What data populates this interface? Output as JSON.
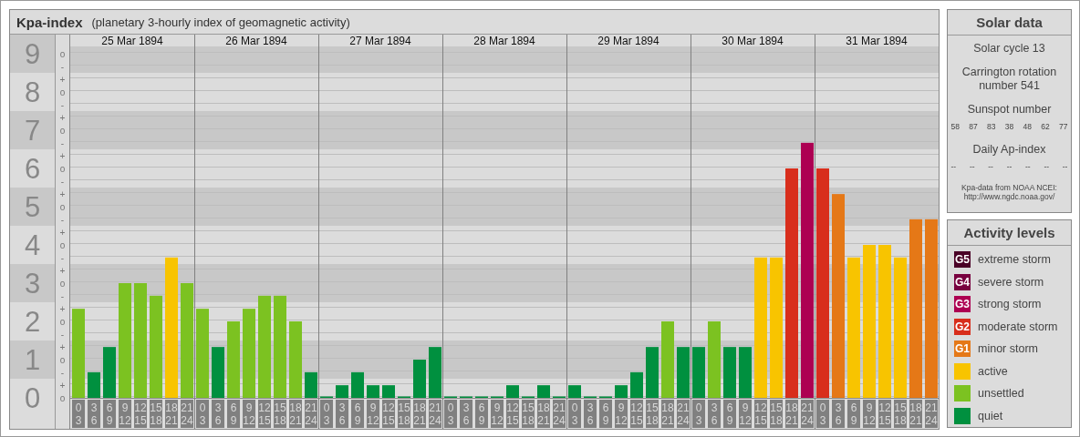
{
  "header": {
    "title": "Kpa-index",
    "subtitle": "(planetary 3-hourly index of geomagnetic activity)"
  },
  "scale": [
    {
      "marks": [
        "o",
        "-"
      ]
    },
    {
      "marks": [
        "+",
        "o",
        "-"
      ]
    },
    {
      "marks": [
        "+",
        "o",
        "-"
      ]
    },
    {
      "marks": [
        "+",
        "o",
        "-"
      ]
    },
    {
      "marks": [
        "+",
        "o",
        "-"
      ]
    },
    {
      "marks": [
        "+",
        "o",
        "-"
      ]
    },
    {
      "marks": [
        "+",
        "o",
        "-"
      ]
    },
    {
      "marks": [
        "+",
        "o",
        "-"
      ]
    },
    {
      "marks": [
        "+",
        "o",
        "-"
      ]
    },
    {
      "marks": [
        "+",
        "o"
      ]
    }
  ],
  "days": [
    {
      "date": "25 Mar 1894",
      "intervals": [
        [
          "0",
          "3"
        ],
        [
          "3",
          "6"
        ],
        [
          "6",
          "9"
        ],
        [
          "9",
          "12"
        ],
        [
          "12",
          "15"
        ],
        [
          "15",
          "18"
        ],
        [
          "18",
          "21"
        ],
        [
          "21",
          "24"
        ]
      ]
    },
    {
      "date": "26 Mar 1894",
      "intervals": [
        [
          "0",
          "3"
        ],
        [
          "3",
          "6"
        ],
        [
          "6",
          "9"
        ],
        [
          "9",
          "12"
        ],
        [
          "12",
          "15"
        ],
        [
          "15",
          "18"
        ],
        [
          "18",
          "21"
        ],
        [
          "21",
          "24"
        ]
      ]
    },
    {
      "date": "27 Mar 1894",
      "intervals": [
        [
          "0",
          "3"
        ],
        [
          "3",
          "6"
        ],
        [
          "6",
          "9"
        ],
        [
          "9",
          "12"
        ],
        [
          "12",
          "15"
        ],
        [
          "15",
          "18"
        ],
        [
          "18",
          "21"
        ],
        [
          "21",
          "24"
        ]
      ]
    },
    {
      "date": "28 Mar 1894",
      "intervals": [
        [
          "0",
          "3"
        ],
        [
          "3",
          "6"
        ],
        [
          "6",
          "9"
        ],
        [
          "9",
          "12"
        ],
        [
          "12",
          "15"
        ],
        [
          "15",
          "18"
        ],
        [
          "18",
          "21"
        ],
        [
          "21",
          "24"
        ]
      ]
    },
    {
      "date": "29 Mar 1894",
      "intervals": [
        [
          "0",
          "3"
        ],
        [
          "3",
          "6"
        ],
        [
          "6",
          "9"
        ],
        [
          "9",
          "12"
        ],
        [
          "12",
          "15"
        ],
        [
          "15",
          "18"
        ],
        [
          "18",
          "21"
        ],
        [
          "21",
          "24"
        ]
      ]
    },
    {
      "date": "30 Mar 1894",
      "intervals": [
        [
          "0",
          "3"
        ],
        [
          "3",
          "6"
        ],
        [
          "6",
          "9"
        ],
        [
          "9",
          "12"
        ],
        [
          "12",
          "15"
        ],
        [
          "15",
          "18"
        ],
        [
          "18",
          "21"
        ],
        [
          "21",
          "24"
        ]
      ]
    },
    {
      "date": "31 Mar 1894",
      "intervals": [
        [
          "0",
          "3"
        ],
        [
          "3",
          "6"
        ],
        [
          "6",
          "9"
        ],
        [
          "9",
          "12"
        ],
        [
          "12",
          "15"
        ],
        [
          "15",
          "18"
        ],
        [
          "18",
          "21"
        ],
        [
          "21",
          "24"
        ]
      ]
    }
  ],
  "chart_data": {
    "type": "bar",
    "ylim": [
      0,
      9.5
    ],
    "yticks": [
      0,
      1,
      2,
      3,
      4,
      5,
      6,
      7,
      8,
      9
    ],
    "grid": true,
    "values": [
      2.33,
      0.67,
      1.33,
      3,
      3,
      2.67,
      3.67,
      3,
      2.33,
      1.33,
      2,
      2.33,
      2.67,
      2.67,
      2,
      0.67,
      0,
      0.33,
      0.67,
      0.33,
      0.33,
      0,
      1,
      1.33,
      0,
      0,
      0,
      0,
      0.33,
      0,
      0.33,
      0,
      0.33,
      0,
      0,
      0.33,
      0.67,
      1.33,
      2,
      1.33,
      1.33,
      2,
      1.33,
      1.33,
      3.67,
      3.67,
      6,
      6.67,
      6,
      5.33,
      3.67,
      4,
      4,
      3.67,
      4.67,
      4.67
    ]
  },
  "solar": {
    "title": "Solar data",
    "cycle": "Solar cycle 13",
    "rotation": "Carrington rotation number 541",
    "sunspot_title": "Sunspot number",
    "sunspots": [
      "58",
      "87",
      "83",
      "38",
      "48",
      "62",
      "77"
    ],
    "ap_title": "Daily Ap-index",
    "ap_values": [
      "--",
      "--",
      "--",
      "--",
      "--",
      "--",
      "--"
    ],
    "source": [
      "Kpa-data from NOAA NCEI:",
      "http://www.ngdc.noaa.gov/"
    ]
  },
  "legend": {
    "title": "Activity levels",
    "items": [
      {
        "badge": "G5",
        "label": "extreme storm",
        "color": "#4a0026"
      },
      {
        "badge": "G4",
        "label": "severe storm",
        "color": "#78003f"
      },
      {
        "badge": "G3",
        "label": "strong storm",
        "color": "#ad0052"
      },
      {
        "badge": "G2",
        "label": "moderate storm",
        "color": "#d82e1c"
      },
      {
        "badge": "G1",
        "label": "minor storm",
        "color": "#e57817"
      },
      {
        "label": "active",
        "color": "#f8c400"
      },
      {
        "label": "unsettled",
        "color": "#7cc221"
      },
      {
        "label": "quiet",
        "color": "#00903f"
      }
    ]
  }
}
